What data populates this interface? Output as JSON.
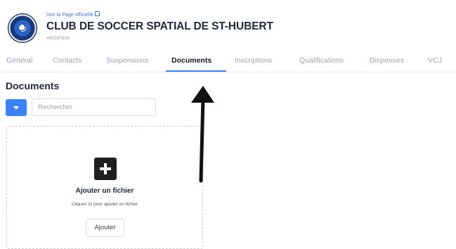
{
  "header": {
    "official_link": "Voir la Page officielle",
    "club_name": "CLUB DE SOCCER SPATIAL DE ST-HUBERT",
    "club_id": "#00287616"
  },
  "tabs": [
    {
      "label": "Général",
      "active": false
    },
    {
      "label": "Contacts",
      "active": false
    },
    {
      "label": "Suspensions",
      "active": false
    },
    {
      "label": "Documents",
      "active": true
    },
    {
      "label": "Inscriptions",
      "active": false
    },
    {
      "label": "Qualifications",
      "active": false
    },
    {
      "label": "Dispenses",
      "active": false
    },
    {
      "label": "VCJ",
      "active": false
    }
  ],
  "documents": {
    "title": "Documents",
    "search_placeholder": "Rechercher",
    "search_value": "",
    "upload": {
      "icon": "plus-icon",
      "title": "Ajouter un fichier",
      "subtitle": "Cliquez ici pour ajouter un fichier",
      "button_label": "Ajouter"
    }
  },
  "annotation": {
    "type": "arrow-up",
    "color": "#111111",
    "points_to": "Documents"
  },
  "colors": {
    "accent": "#3b82f6",
    "link": "#3b6fd8",
    "text": "#1f2937",
    "muted": "#9aa3b2"
  }
}
